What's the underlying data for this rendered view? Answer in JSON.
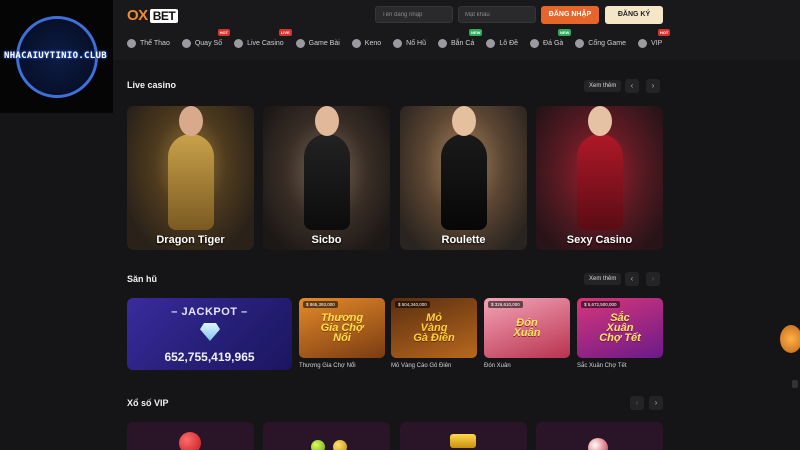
{
  "header": {
    "logo_ox": "OX",
    "logo_bet": "BET",
    "username_placeholder": "Tên đăng nhập",
    "password_placeholder": "Mật khẩu",
    "login_label": "ĐĂNG NHẬP",
    "register_label": "ĐĂNG KÝ"
  },
  "nav": [
    {
      "label": "Thể Thao",
      "icon": "soccer-ball-icon",
      "badge": ""
    },
    {
      "label": "Quay Số",
      "icon": "lottery-icon",
      "badge": "HOT"
    },
    {
      "label": "Live Casino",
      "icon": "live-casino-icon",
      "badge": "LIVE"
    },
    {
      "label": "Game Bài",
      "icon": "cards-icon",
      "badge": ""
    },
    {
      "label": "Keno",
      "icon": "keno-icon",
      "badge": ""
    },
    {
      "label": "Nổ Hũ",
      "icon": "jackpot-icon",
      "badge": ""
    },
    {
      "label": "Bắn Cá",
      "icon": "fish-icon",
      "badge": "NEW"
    },
    {
      "label": "Lô Đề",
      "icon": "lotto-icon",
      "badge": ""
    },
    {
      "label": "Đá Gà",
      "icon": "rooster-icon",
      "badge": "NEW"
    },
    {
      "label": "Cổng Game",
      "icon": "game-portal-icon",
      "badge": ""
    },
    {
      "label": "VIP",
      "icon": "vip-icon",
      "badge": "HOT"
    }
  ],
  "watermark": {
    "text": "NHACAIUYTINIO.CLUB"
  },
  "live_casino": {
    "title": "Live casino",
    "more": "Xem thêm",
    "prev": "‹",
    "next": "›",
    "cards": [
      {
        "label": "Dragon Tiger"
      },
      {
        "label": "Sicbo"
      },
      {
        "label": "Roulette"
      },
      {
        "label": "Sexy Casino"
      }
    ]
  },
  "san_hu": {
    "title": "Săn hũ",
    "more": "Xem thêm",
    "prev": "‹",
    "next": "›",
    "jackpot_title": "– JACKPOT –",
    "jackpot_amount": "652,755,419,965",
    "games": [
      {
        "amount": "$ 865,393,000",
        "art": "Thương Gia Chợ Nổi",
        "caption": "Thương Gia Chợ Nổi"
      },
      {
        "amount": "$ 504,340,000",
        "art": "Mỏ Vàng Gà Điên",
        "caption": "Mỏ Vàng Cáo Gô Điên"
      },
      {
        "amount": "$ 326,610,000",
        "art": "Đón Xuân",
        "caption": "Đón Xuân"
      },
      {
        "amount": "$ 5,672,500,000",
        "art": "Sắc Xuân Chợ Tết",
        "caption": "Sắc Xuân Chợ Tết"
      }
    ]
  },
  "xo_so_vip": {
    "title": "Xổ số VIP",
    "prev": "‹",
    "next": "›"
  },
  "colors": {
    "accent": "#e5652a",
    "register_bg": "#f6e6c8",
    "background": "#151517"
  }
}
